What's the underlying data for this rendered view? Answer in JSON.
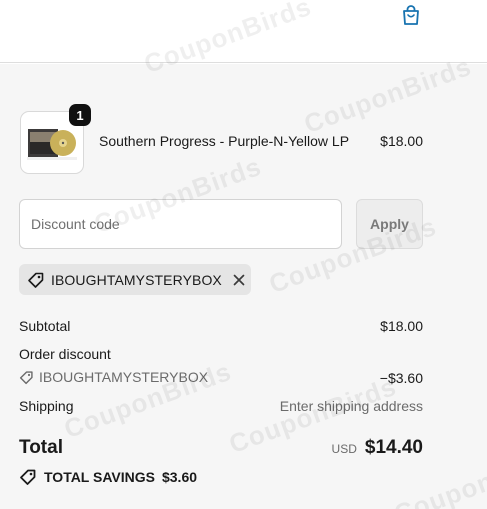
{
  "header": {
    "cart_icon": "shopping-bag-icon",
    "accent_color": "#1773b0"
  },
  "line_item": {
    "quantity": "1",
    "name": "Southern Progress - Purple-N-Yellow LP",
    "price": "$18.00"
  },
  "discount": {
    "placeholder": "Discount code",
    "apply_label": "Apply",
    "applied_code": "IBOUGHTAMYSTERYBOX"
  },
  "totals": {
    "subtotal_label": "Subtotal",
    "subtotal_value": "$18.00",
    "order_discount_label": "Order discount",
    "discount_code": "IBOUGHTAMYSTERYBOX",
    "discount_value": "−$3.60",
    "shipping_label": "Shipping",
    "shipping_value": "Enter shipping address",
    "total_label": "Total",
    "currency": "USD",
    "total_value": "$14.40",
    "savings_label": "TOTAL SAVINGS",
    "savings_value": "$3.60"
  },
  "watermark": "CouponBirds"
}
